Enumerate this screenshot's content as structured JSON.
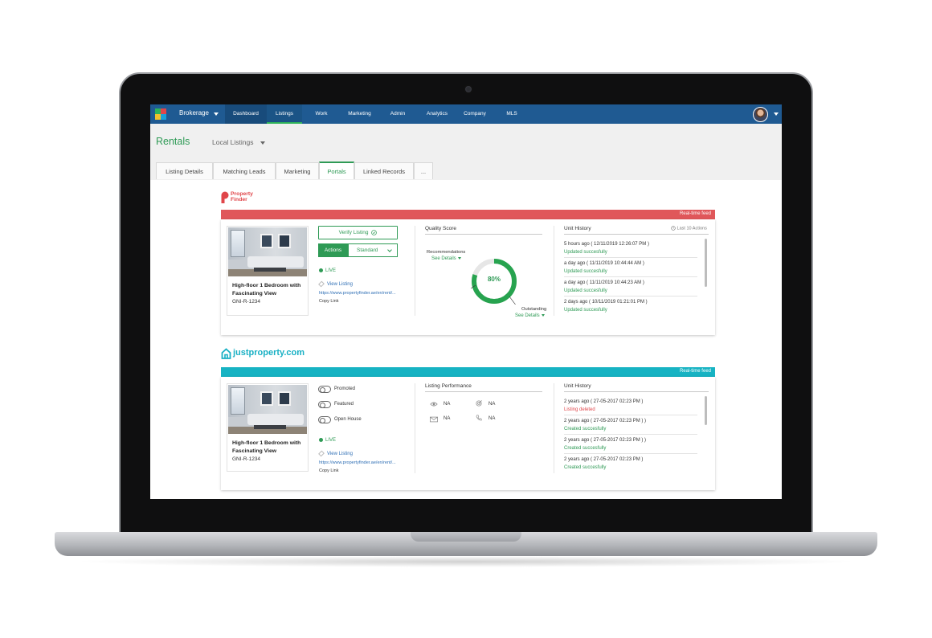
{
  "nav": {
    "brokerage": "Brokerage",
    "items": [
      "Dashboard",
      "Listings",
      "Work",
      "Marketing",
      "Admin",
      "Analytics",
      "Company",
      "MLS"
    ]
  },
  "header": {
    "title": "Rentals",
    "local_listings": "Local Listings"
  },
  "tabs": [
    "Listing Details",
    "Matching Leads",
    "Marketing",
    "Portals",
    "Linked Records",
    "..."
  ],
  "portals": {
    "property_finder": {
      "logo_line1": "Property",
      "logo_line2": "Finder",
      "banner": "Real-time feed",
      "listing_title": "High-floor 1 Bedroom with Fascinating View",
      "listing_ref": "GNI-R-1234",
      "verify_label": "Verify Listing",
      "actions_label": "Actions",
      "standard_label": "Standard",
      "status": "LIVE",
      "view_listing": "View Listing",
      "url": "https://www.propertyfinder.ae/en/rent/...",
      "copy_link": "Copy Link",
      "quality_title": "Quality Score",
      "recommendations": "Recommendations",
      "see_details": "See Details",
      "score": "80%",
      "score_fraction": 0.8,
      "outstanding": "Outstanding",
      "history_title": "Unit History",
      "history_meta": "Last 10 Actions",
      "history": [
        {
          "time": "5 hours ago ( 12/11/2019 12:26:07 PM )",
          "status": "Updated succesfully"
        },
        {
          "time": "a day ago ( 11/11/2019 10:44:44 AM )",
          "status": "Updated succesfully"
        },
        {
          "time": "a day ago ( 11/11/2019 10:44:23 AM )",
          "status": "Updated succesfully"
        },
        {
          "time": "2 days ago ( 10/11/2019 01:21:01 PM )",
          "status": "Updated succesfully"
        }
      ]
    },
    "just_property": {
      "logo": "justproperty.com",
      "banner": "Real-time feed",
      "listing_title": "High-floor 1 Bedroom with Fascinating View",
      "listing_ref": "GNI-R-1234",
      "toggles": [
        "Promoted",
        "Featured",
        "Open House"
      ],
      "status": "LIVE",
      "view_listing": "View Listing",
      "url": "https://www.propertyfinder.ae/en/rent/...",
      "copy_link": "Copy Link",
      "performance_title": "Listing Performance",
      "performance": {
        "views": "NA",
        "target": "NA",
        "emails": "NA",
        "calls": "NA"
      },
      "history_title": "Unit History",
      "history": [
        {
          "time": "2 years ago ( 27-05-2017 02:23 PM )",
          "status": "Listing deleted",
          "error": true
        },
        {
          "time": "2 years ago ( 27-05-2017 02:23 PM ) )",
          "status": "Created succesfully"
        },
        {
          "time": "2 years ago ( 27-05-2017 02:23 PM ) )",
          "status": "Created succesfully"
        },
        {
          "time": "2 years ago ( 27-05-2017 02:23 PM )",
          "status": "Created succesfully"
        }
      ]
    }
  },
  "colors": {
    "brand_blue": "#1f5a92",
    "accent_green": "#2e9a55",
    "pf_red": "#e0464a",
    "jp_teal": "#18b0c4"
  }
}
